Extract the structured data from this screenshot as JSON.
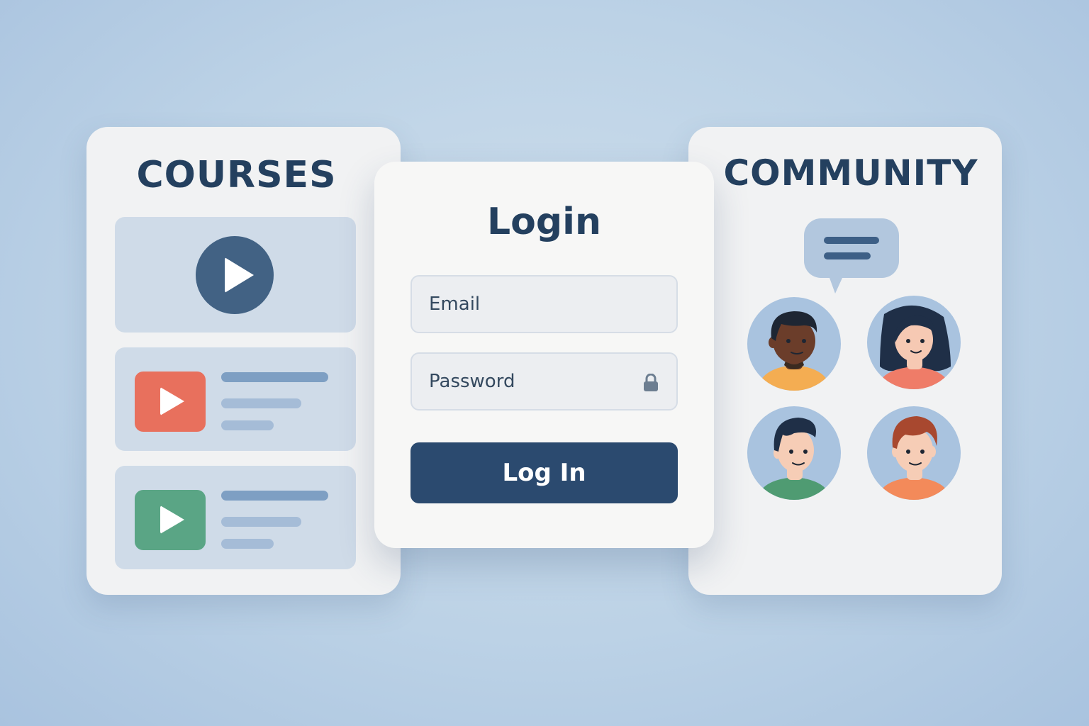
{
  "courses": {
    "title": "COURSES",
    "cards": [
      {
        "type": "featured",
        "icon": "play-circle-icon"
      },
      {
        "type": "list-item",
        "icon": "play-icon",
        "thumb_color": "#e8705d"
      },
      {
        "type": "list-item",
        "icon": "play-icon",
        "thumb_color": "#5aa585"
      }
    ]
  },
  "login": {
    "title": "Login",
    "email_placeholder": "Email",
    "password_placeholder": "Password",
    "button_label": "Log In"
  },
  "community": {
    "title": "COMMUNITY",
    "icons": [
      "chat-bubble-icon",
      "avatar-1",
      "avatar-2",
      "avatar-3",
      "avatar-4"
    ]
  },
  "colors": {
    "accent": "#2b4a6f",
    "title_text": "#24405f",
    "featured_play": "#426284",
    "thumb_red": "#e8705d",
    "thumb_green": "#5aa585"
  }
}
